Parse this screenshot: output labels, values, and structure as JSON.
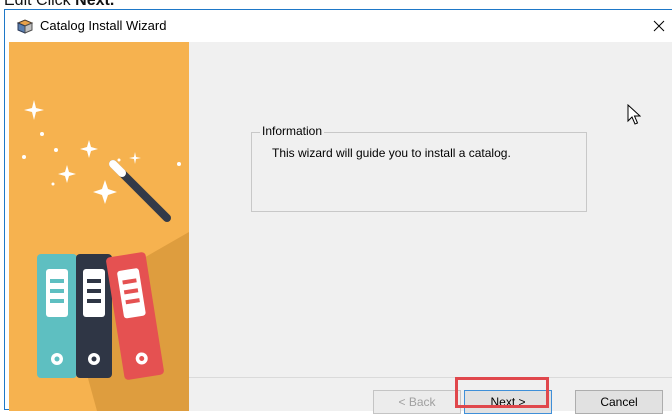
{
  "instruction": {
    "prefix": "Edit Click",
    "emphasis": "Next."
  },
  "window": {
    "title": "Catalog Install Wizard",
    "close_glyph": "✕"
  },
  "sidebar": {
    "background_color": "#f6b24f",
    "illustration": "magic-wand-and-binders"
  },
  "info_group": {
    "legend": "Information",
    "text": "This wizard will guide you to install a catalog."
  },
  "buttons": {
    "back": "< Back",
    "next": "Next >",
    "cancel": "Cancel"
  },
  "highlight": {
    "target": "next-button",
    "color": "#e0474c"
  }
}
